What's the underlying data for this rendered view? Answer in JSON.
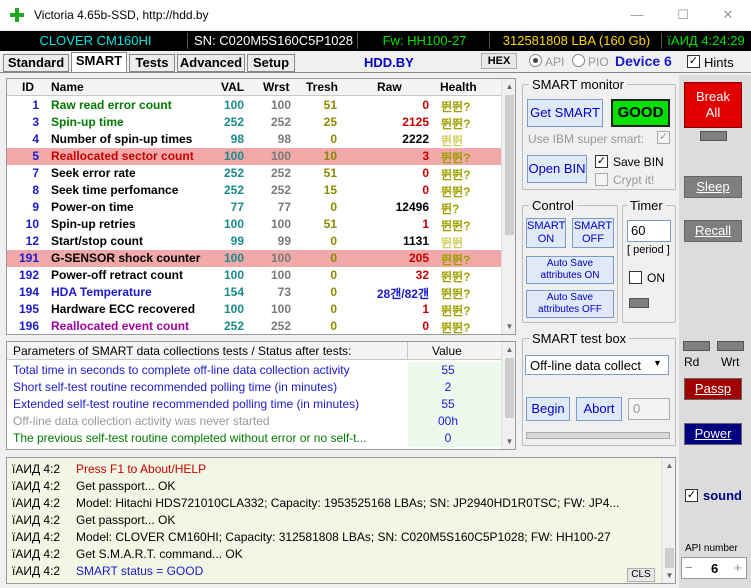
{
  "window": {
    "title": "Victoria 4.65b-SSD, http://hdd.by",
    "minimize_glyph": "—",
    "maximize_glyph": "☐",
    "close_glyph": "✕"
  },
  "info_strip": {
    "model": "CLOVER  CM160HI",
    "serial": "SN: C020M5S160C5P1028",
    "firmware": "Fw: HH100-27",
    "capacity": "312581808 LBA (160 Gb)",
    "clock": "ïАИД 4:24:29"
  },
  "tabs": [
    "Standard",
    "SMART",
    "Tests",
    "Advanced",
    "Setup"
  ],
  "active_tab": "SMART",
  "toolbar": {
    "site": "HDD.BY",
    "hex_label": "HEX",
    "api_label": "API",
    "pio_label": "PIO",
    "device_label": "Device 6",
    "hints_label": "Hints"
  },
  "smart_table": {
    "columns": [
      "ID",
      "Name",
      "VAL",
      "Wrst",
      "Tresh",
      "Raw",
      "Health"
    ],
    "rows": [
      {
        "id": "1",
        "name": "Raw read error count",
        "val": "100",
        "wrst": "100",
        "tresh": "51",
        "raw": "0",
        "health": "뛴뛴?",
        "name_color": "#007a00",
        "highlight": false
      },
      {
        "id": "3",
        "name": "Spin-up time",
        "val": "252",
        "wrst": "252",
        "tresh": "25",
        "raw": "2125",
        "health": "뛴뛴?",
        "name_color": "#007a00",
        "highlight": false
      },
      {
        "id": "4",
        "name": "Number of spin-up times",
        "val": "98",
        "wrst": "98",
        "tresh": "0",
        "raw": "2222",
        "health": "뛴뛴",
        "name_color": "#000000",
        "highlight": false
      },
      {
        "id": "5",
        "name": "Reallocated sector count",
        "val": "100",
        "wrst": "100",
        "tresh": "10",
        "raw": "3",
        "health": "뛴뛴?",
        "name_color": "#c80000",
        "highlight": true
      },
      {
        "id": "7",
        "name": "Seek error rate",
        "val": "252",
        "wrst": "252",
        "tresh": "51",
        "raw": "0",
        "health": "뛴뛴?",
        "name_color": "#000000",
        "highlight": false
      },
      {
        "id": "8",
        "name": "Seek time perfomance",
        "val": "252",
        "wrst": "252",
        "tresh": "15",
        "raw": "0",
        "health": "뛴뛴?",
        "name_color": "#000000",
        "highlight": false
      },
      {
        "id": "9",
        "name": "Power-on time",
        "val": "77",
        "wrst": "77",
        "tresh": "0",
        "raw": "12496",
        "health": "뛴?",
        "name_color": "#000000",
        "highlight": false
      },
      {
        "id": "10",
        "name": "Spin-up retries",
        "val": "100",
        "wrst": "100",
        "tresh": "51",
        "raw": "1",
        "health": "뛴뛴?",
        "name_color": "#000000",
        "highlight": false
      },
      {
        "id": "12",
        "name": "Start/stop count",
        "val": "99",
        "wrst": "99",
        "tresh": "0",
        "raw": "1131",
        "health": "뛴뛴",
        "name_color": "#000000",
        "highlight": false
      },
      {
        "id": "191",
        "name": "G-SENSOR shock counter",
        "val": "100",
        "wrst": "100",
        "tresh": "0",
        "raw": "205",
        "health": "뛴뛴?",
        "name_color": "#000000",
        "highlight": true
      },
      {
        "id": "192",
        "name": "Power-off retract count",
        "val": "100",
        "wrst": "100",
        "tresh": "0",
        "raw": "32",
        "health": "뛴뛴?",
        "name_color": "#000000",
        "highlight": false
      },
      {
        "id": "194",
        "name": "HDA Temperature",
        "val": "154",
        "wrst": "73",
        "tresh": "0",
        "raw": "28갠/82갠",
        "health": "뛴뛴?",
        "name_color": "#1a1acc",
        "highlight": false
      },
      {
        "id": "195",
        "name": "Hardware ECC recovered",
        "val": "100",
        "wrst": "100",
        "tresh": "0",
        "raw": "1",
        "health": "뛴뛴?",
        "name_color": "#000000",
        "highlight": false
      },
      {
        "id": "196",
        "name": "Reallocated event count",
        "val": "252",
        "wrst": "252",
        "tresh": "0",
        "raw": "0",
        "health": "뛴뛴?",
        "name_color": "#a000a0",
        "highlight": false
      }
    ]
  },
  "params": {
    "header": "Parameters of SMART data collections tests / Status after tests:",
    "value_header": "Value",
    "rows": [
      {
        "label": "Total time in seconds to complete off-line data collection activity",
        "value": "55",
        "color": "#1a1acc"
      },
      {
        "label": "Short self-test routine recommended polling time (in minutes)",
        "value": "2",
        "color": "#1a1acc"
      },
      {
        "label": "Extended self-test routine recommended polling time (in minutes)",
        "value": "55",
        "color": "#1a1acc"
      },
      {
        "label": "Off-line data collection activity was never started",
        "value": "00h",
        "color": "#9a9a9a"
      },
      {
        "label": "The previous self-test routine completed without error or no self-t...",
        "value": "0",
        "color": "#007a00"
      }
    ]
  },
  "smart_monitor": {
    "title": "SMART monitor",
    "get_smart": "Get SMART",
    "status": "GOOD",
    "ibm_label": "Use IBM super smart:",
    "open_bin": "Open BIN",
    "save_bin": "Save BIN",
    "crypt_it": "Crypt it!"
  },
  "control": {
    "title": "Control",
    "smart_on": "SMART ON",
    "smart_off": "SMART OFF",
    "autosave_on": "Auto Save attributes ON",
    "autosave_off": "Auto Save attributes OFF"
  },
  "timer": {
    "title": "Timer",
    "value": "60",
    "period_label": "[ period ]",
    "on_label": "ON"
  },
  "test_box": {
    "title": "SMART test box",
    "selected": "Off-line data collect",
    "begin": "Begin",
    "abort": "Abort",
    "counter": "0"
  },
  "right_panel": {
    "break_all": "Break All",
    "sleep": "Sleep",
    "recall": "Recall",
    "rd": "Rd",
    "wrt": "Wrt",
    "passp": "Passp",
    "power": "Power",
    "sound": "sound",
    "api_number_label": "API number",
    "api_number": "6"
  },
  "log": {
    "lines": [
      {
        "prefix": "ïАИД 4:2",
        "text": "Press F1 to About/HELP",
        "color": "#c80000"
      },
      {
        "prefix": "ïАИД 4:2",
        "text": "Get passport... OK",
        "color": "#000000"
      },
      {
        "prefix": "ïАИД 4:2",
        "text": "Model: Hitachi HDS721010CLA332; Capacity: 1953525168 LBAs; SN: JP2940HD1R0TSC; FW: JP4...",
        "color": "#000000"
      },
      {
        "prefix": "ïАИД 4:2",
        "text": "Get passport... OK",
        "color": "#000000"
      },
      {
        "prefix": "ïАИД 4:2",
        "text": "Model: CLOVER  CM160HI; Capacity: 312581808 LBAs; SN: C020M5S160C5P1028; FW: HH100-27",
        "color": "#000000"
      },
      {
        "prefix": "ïАИД 4:2",
        "text": "Get S.M.A.R.T. command... OK",
        "color": "#000000"
      },
      {
        "prefix": "ïАИД 4:2",
        "text": "SMART status = GOOD",
        "color": "#1a1acc"
      }
    ],
    "cls": "CLS"
  },
  "colors": {
    "accent_blue": "#1a1acc",
    "good_green": "#00e000",
    "break_red": "#e00000",
    "highlight_row": "#f1a8a8",
    "log_bg": "#f2f6e4"
  }
}
